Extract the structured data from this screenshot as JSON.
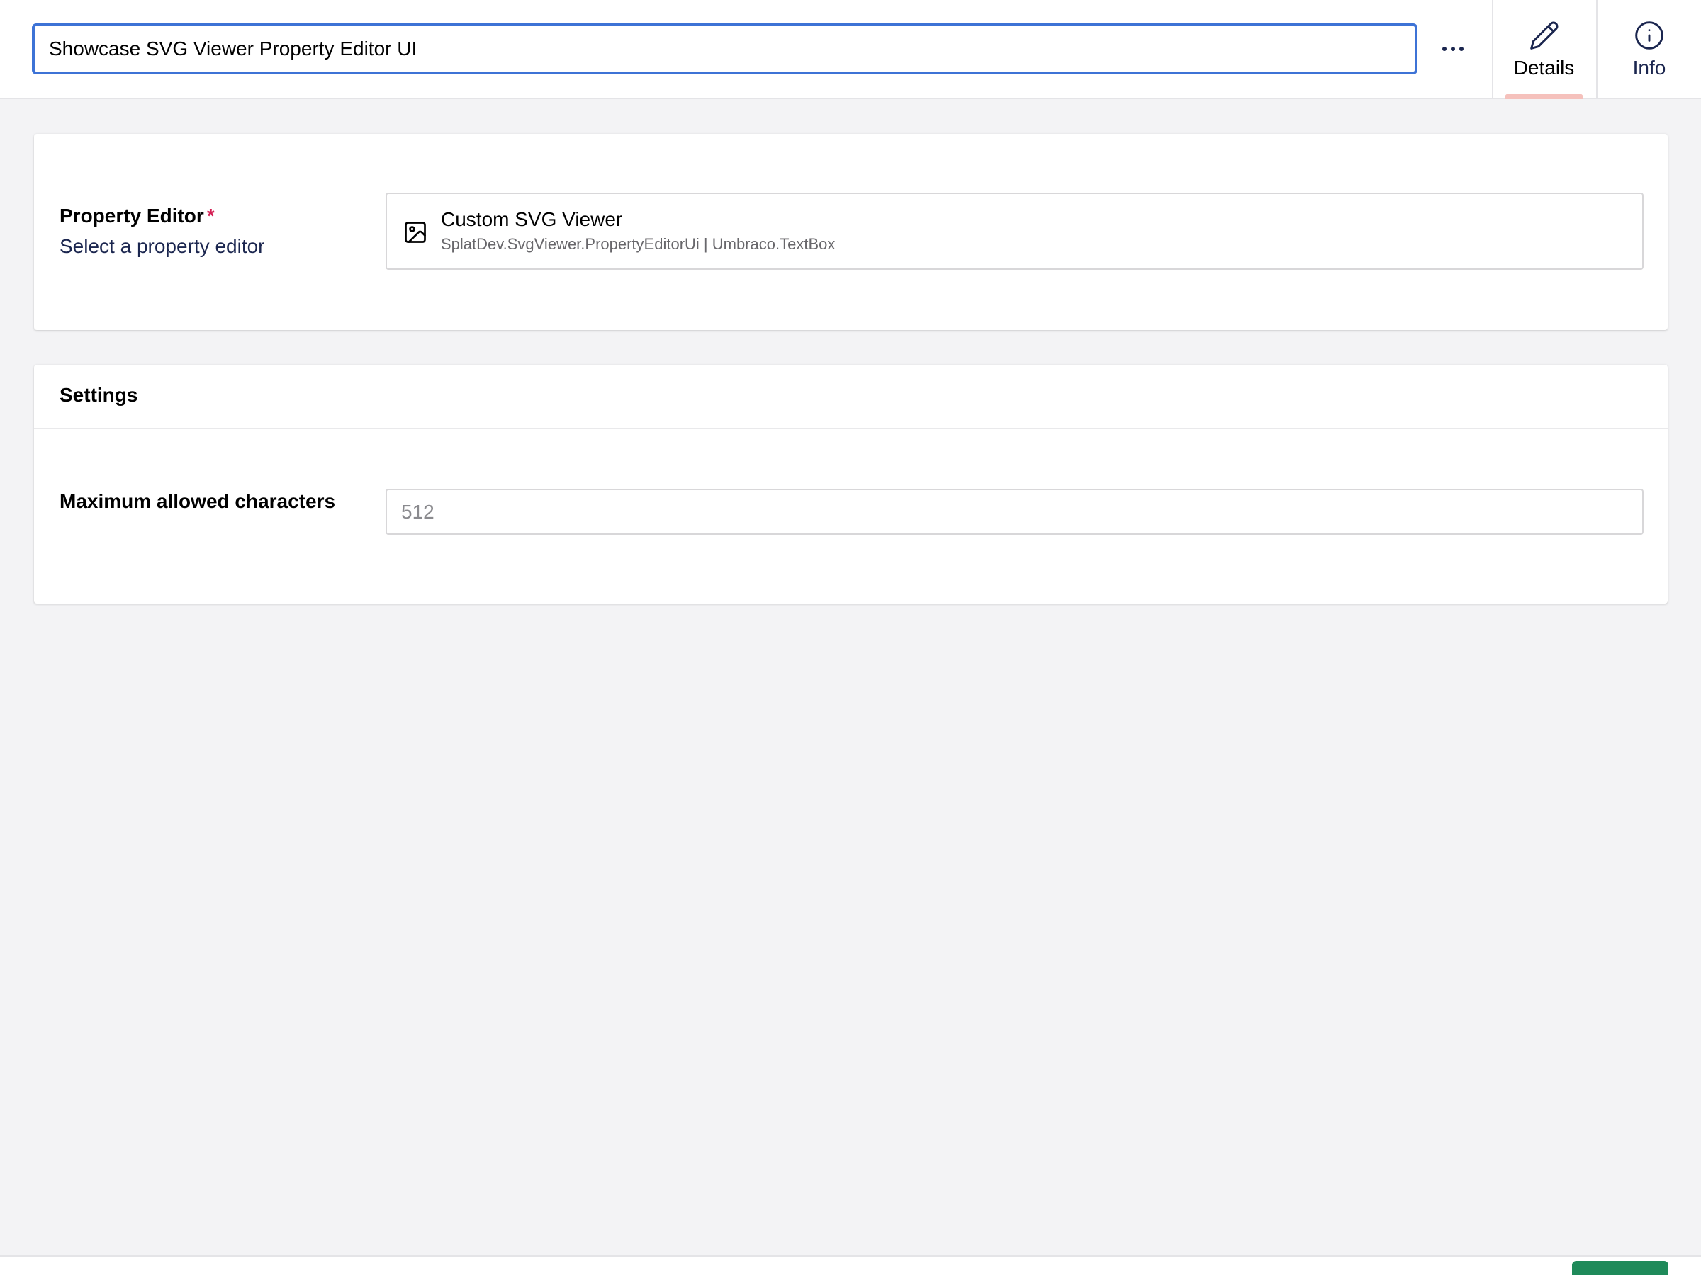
{
  "header": {
    "name_value": "Showcase SVG Viewer Property Editor UI",
    "more_actions_icon": "ellipsis-icon",
    "tabs": [
      {
        "label": "Details",
        "icon": "pencil-icon",
        "active": true
      },
      {
        "label": "Info",
        "icon": "info-icon",
        "active": false
      }
    ]
  },
  "property_editor": {
    "label": "Property Editor",
    "required_mark": "*",
    "description": "Select a property editor",
    "selected": {
      "icon": "image-icon",
      "name": "Custom SVG Viewer",
      "alias": "SplatDev.SvgViewer.PropertyEditorUi | Umbraco.TextBox"
    }
  },
  "settings": {
    "title": "Settings",
    "fields": [
      {
        "label": "Maximum allowed characters",
        "placeholder": "512",
        "value": ""
      }
    ]
  },
  "colors": {
    "focus_border": "#3d73d6",
    "active_tab_indicator": "#f5c1bc",
    "required": "#d42054",
    "footer_action": "#1f8a5a"
  }
}
